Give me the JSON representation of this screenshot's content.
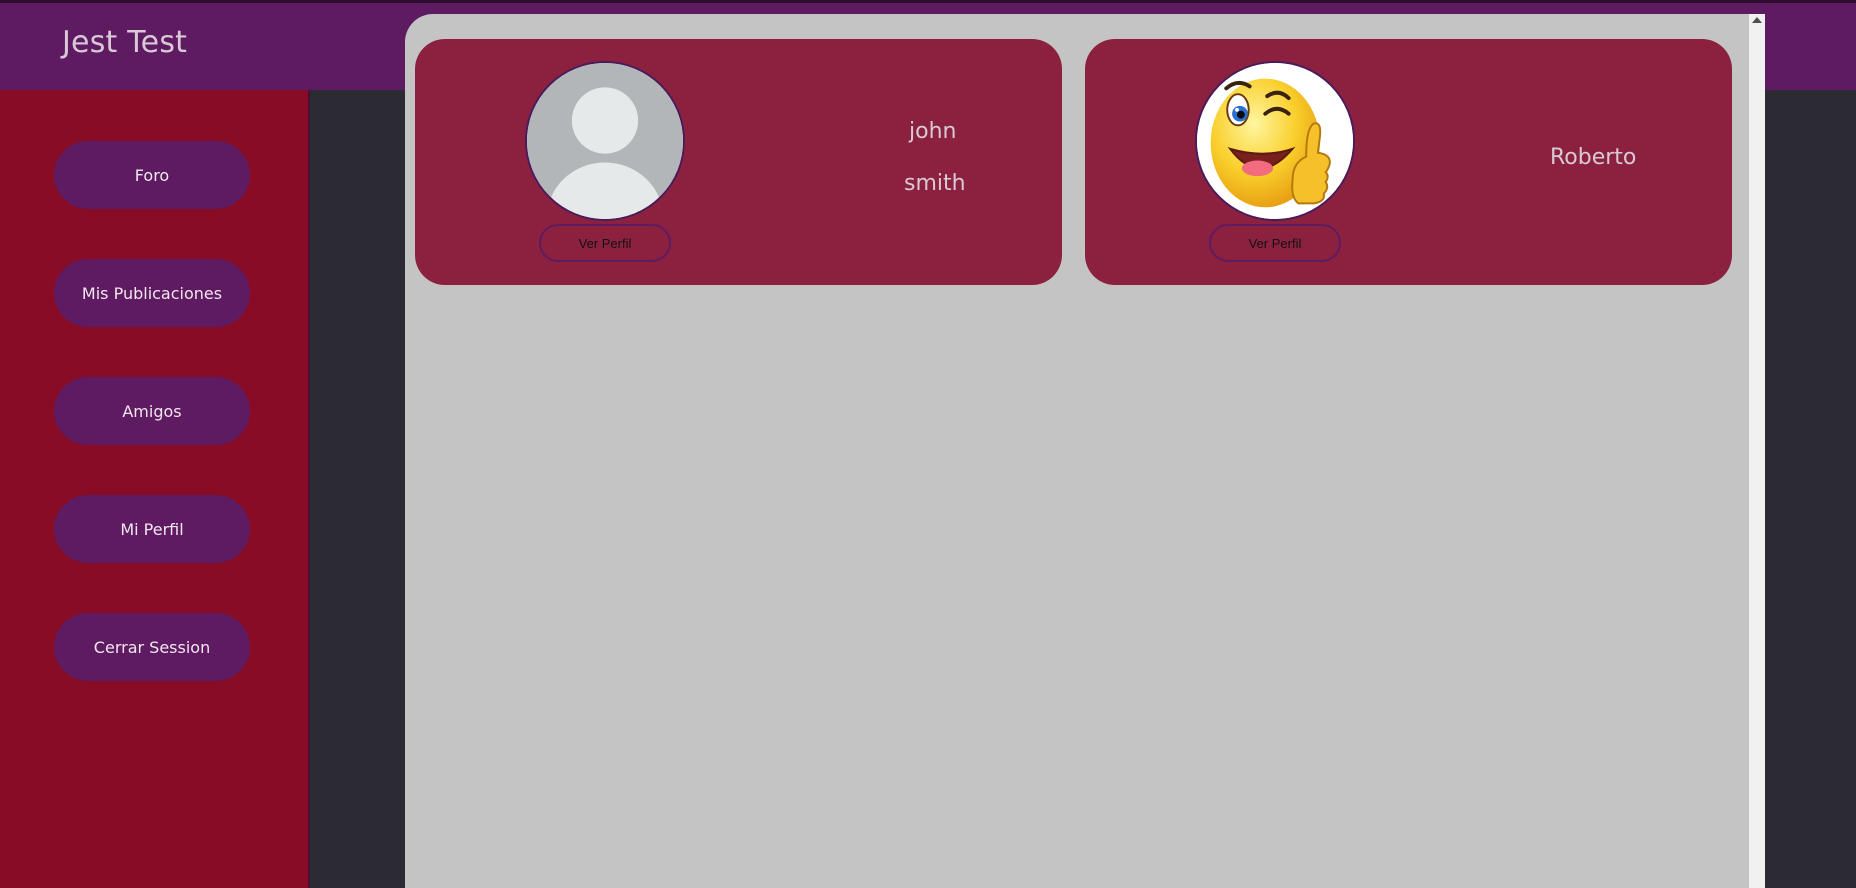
{
  "header": {
    "title": "Jest Test"
  },
  "sidebar": {
    "items": [
      {
        "label": "Foro"
      },
      {
        "label": "Mis Publicaciones"
      },
      {
        "label": "Amigos"
      },
      {
        "label": "Mi Perfil"
      },
      {
        "label": "Cerrar Session"
      }
    ]
  },
  "friends": [
    {
      "first_name": "john",
      "last_name": "smith",
      "avatar": "default-user-icon",
      "button_label": "Ver Perfil"
    },
    {
      "first_name": "Roberto",
      "avatar": "winking-emoji-thumbs-up-icon",
      "button_label": "Ver Perfil"
    }
  ],
  "colors": {
    "topbar": "#5f1b62",
    "sidebar": "#880c26",
    "card": "#8c213f",
    "panel": "#c4c4c4",
    "background": "#2c2a33"
  }
}
